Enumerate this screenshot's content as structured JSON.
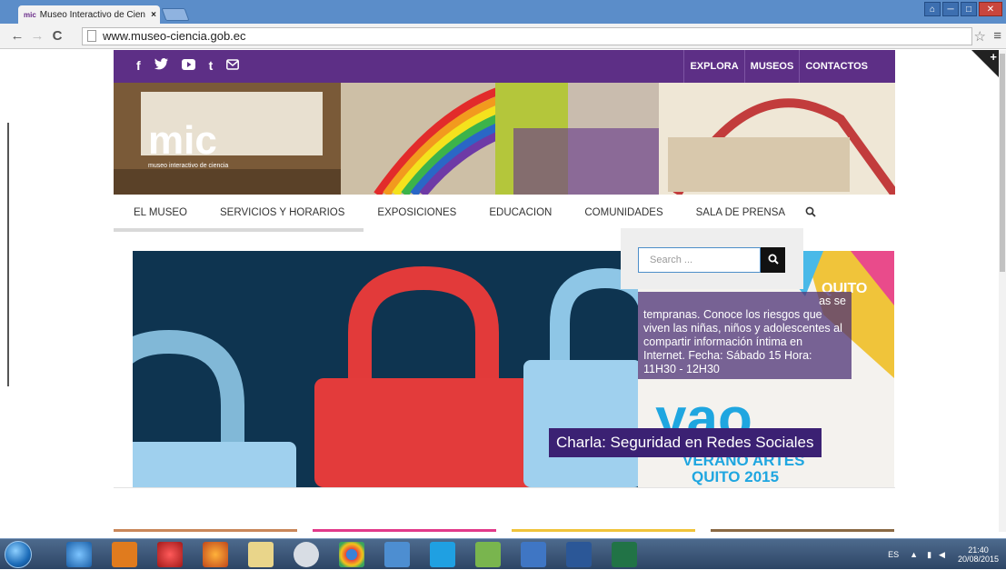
{
  "browser": {
    "tab_title": "Museo Interactivo de Cien",
    "tab_favicon": "mic",
    "tab_close": "×",
    "url": "www.museo-ciencia.gob.ec",
    "back_icon": "←",
    "forward_icon": "→",
    "reload_icon": "C",
    "star_icon": "☆",
    "menu_icon": "≡",
    "window_buttons": [
      "⌂",
      "─",
      "□",
      "✕"
    ]
  },
  "topbar": {
    "social_icons": [
      "f",
      "🐦",
      "▶",
      "t",
      "✉"
    ],
    "nav": [
      "EXPLORA",
      "MUSEOS",
      "CONTACTOS"
    ]
  },
  "hero": {
    "logo": "mic",
    "logo_subtitle": "museo interactivo de ciencia"
  },
  "mainnav": [
    "EL MUSEO",
    "SERVICIOS Y HORARIOS",
    "EXPOSICIONES",
    "EDUCACION",
    "COMUNIDADES",
    "SALA DE PRENSA"
  ],
  "search": {
    "placeholder": "Search ...",
    "button_icon": "search-icon"
  },
  "slide": {
    "partial_text": "as se",
    "body": "tempranas. Conoce los riesgos que viven las niñas, niños y adolescentes al compartir información íntima en Internet.   Fecha: Sábado 15 Hora: 11H30 - 12H30",
    "title": "Charla: Seguridad en Redes Sociales",
    "logo_text": "yao",
    "logo_sub1": "VERANO ARTES",
    "logo_sub2": "QUITO 2015",
    "quito_badge": "QUITO"
  },
  "taskbar": {
    "lang": "ES",
    "time": "21:40",
    "date": "20/08/2015"
  },
  "colors": {
    "brand_purple": "#5d2f86",
    "slide_title_bg": "#3b2173",
    "titlebar_blue": "#5b8dc9"
  }
}
